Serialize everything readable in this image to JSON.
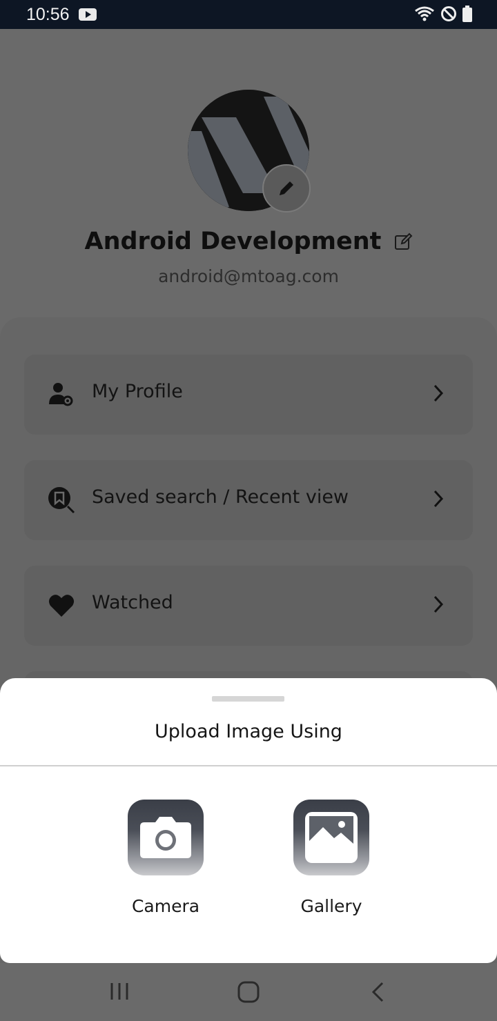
{
  "status_bar": {
    "time": "10:56",
    "icons": [
      "youtube-icon",
      "wifi-icon",
      "do-not-disturb-icon",
      "battery-icon"
    ]
  },
  "profile": {
    "name": "Android Development",
    "email": "android@mtoag.com"
  },
  "menu": {
    "items": [
      {
        "label": "My Profile",
        "icon": "user-settings-icon"
      },
      {
        "label": "Saved search / Recent view",
        "icon": "saved-search-icon"
      },
      {
        "label": "Watched",
        "icon": "heart-icon"
      }
    ]
  },
  "sheet": {
    "title": "Upload Image Using",
    "options": [
      {
        "label": "Camera",
        "icon": "camera-icon"
      },
      {
        "label": "Gallery",
        "icon": "gallery-icon"
      }
    ]
  },
  "nav_bar": {
    "buttons": [
      "recents-icon",
      "home-icon",
      "back-icon"
    ]
  },
  "colors": {
    "status_bar_bg": "#0d1624",
    "scrim_bg": "#6a6a6a",
    "sheet_bg": "#ffffff"
  }
}
